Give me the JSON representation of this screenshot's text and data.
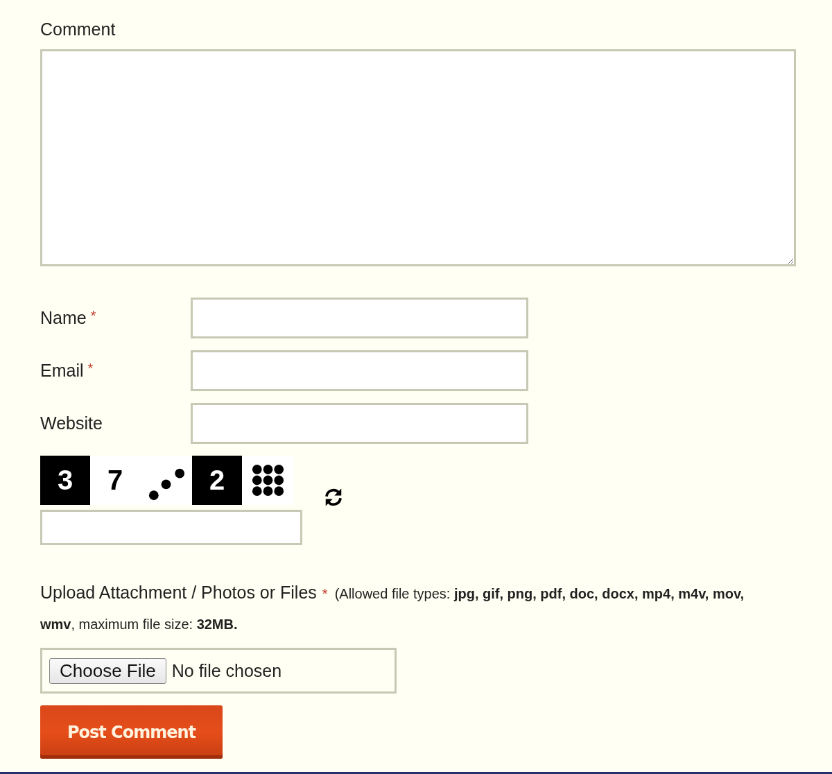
{
  "comment": {
    "label": "Comment"
  },
  "fields": [
    {
      "label": "Name",
      "required_mark": "*"
    },
    {
      "label": "Email",
      "required_mark": "*"
    },
    {
      "label": "Website"
    }
  ],
  "captcha": {
    "tiles": [
      {
        "kind": "digit",
        "text": "3",
        "dark": true
      },
      {
        "kind": "digit",
        "text": "7",
        "dark": false
      },
      {
        "kind": "diagonal"
      },
      {
        "kind": "digit",
        "text": "2",
        "dark": true
      },
      {
        "kind": "grid"
      }
    ]
  },
  "upload": {
    "label": "Upload Attachment / Photos or Files",
    "required_mark": "*",
    "note": "(Allowed file types: **jpg, gif, png, pdf, doc, docx, mp4, m4v, mov, wmv**, maximum file size: **32MB.**",
    "button": "Choose File",
    "status": "No file chosen"
  },
  "submit": "Post Comment"
}
